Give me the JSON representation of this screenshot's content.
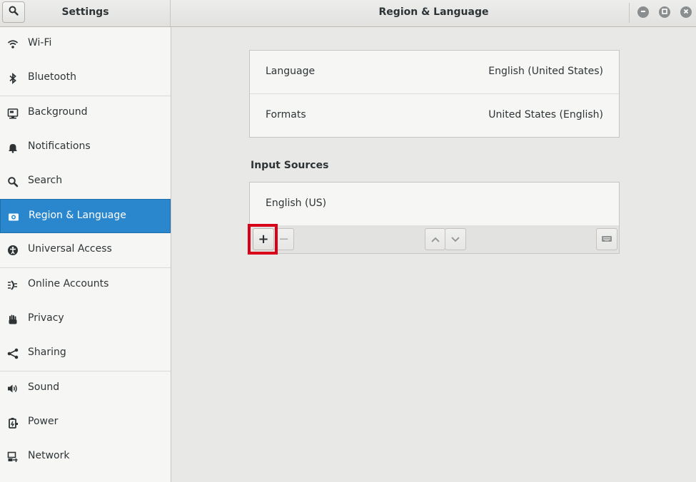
{
  "window": {
    "app_title": "Settings",
    "page_title": "Region & Language"
  },
  "header": {
    "search_icon": "search-icon",
    "window_controls": [
      "minimize-icon",
      "maximize-icon",
      "close-icon"
    ]
  },
  "sidebar": {
    "items": [
      {
        "label": "Wi-Fi",
        "icon": "wifi-icon"
      },
      {
        "label": "Bluetooth",
        "icon": "bluetooth-icon"
      },
      {
        "label": "Background",
        "icon": "background-icon"
      },
      {
        "label": "Notifications",
        "icon": "bell-icon"
      },
      {
        "label": "Search",
        "icon": "search-icon"
      },
      {
        "label": "Region & Language",
        "icon": "camera-icon",
        "selected": true
      },
      {
        "label": "Universal Access",
        "icon": "accessibility-icon"
      },
      {
        "label": "Online Accounts",
        "icon": "online-accounts-icon"
      },
      {
        "label": "Privacy",
        "icon": "hand-icon"
      },
      {
        "label": "Sharing",
        "icon": "share-icon"
      },
      {
        "label": "Sound",
        "icon": "speaker-icon"
      },
      {
        "label": "Power",
        "icon": "power-icon"
      },
      {
        "label": "Network",
        "icon": "network-icon"
      }
    ],
    "selected_color": "#2a86cd"
  },
  "main": {
    "language": {
      "label": "Language",
      "value": "English (United States)"
    },
    "formats": {
      "label": "Formats",
      "value": "United States (English)"
    },
    "input_sources": {
      "title": "Input Sources",
      "items": [
        "English (US)"
      ],
      "toolbar": {
        "add_label": "+",
        "remove_label": "−",
        "up_icon": "chevron-up-icon",
        "down_icon": "chevron-down-icon",
        "keyboard_icon": "keyboard-icon"
      }
    }
  },
  "annotation": {
    "highlight_color": "#d9001a"
  }
}
